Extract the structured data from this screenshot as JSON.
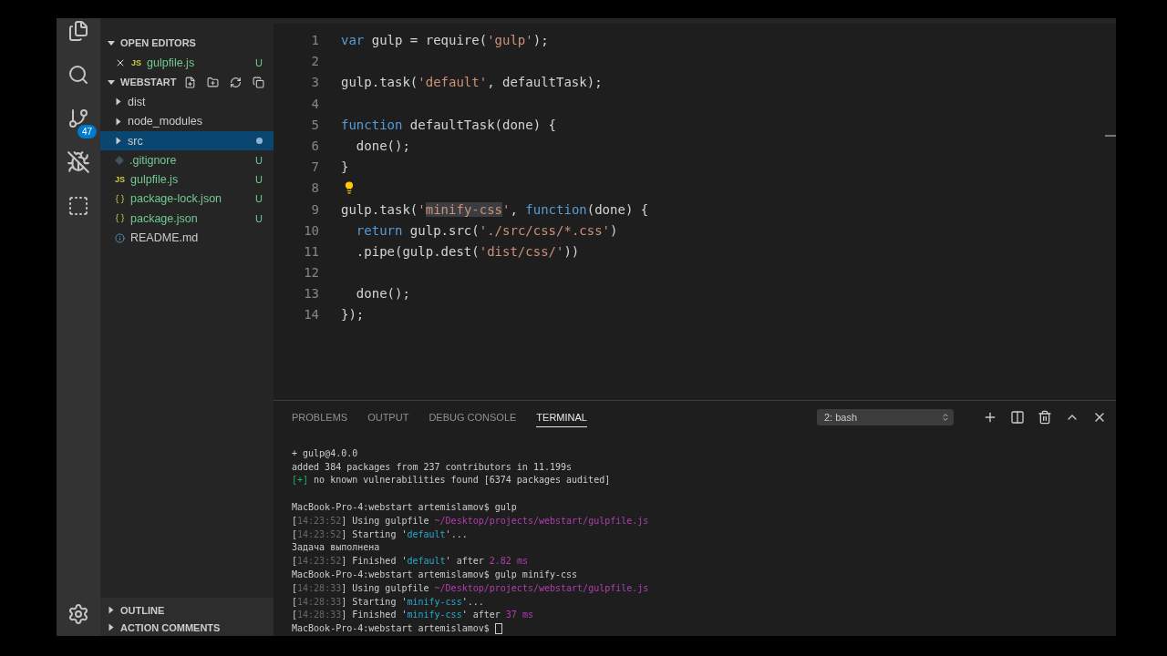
{
  "activity_bar": {
    "items": [
      {
        "kind": "files"
      },
      {
        "kind": "search"
      },
      {
        "kind": "source-control",
        "badge": "47"
      },
      {
        "kind": "debug"
      },
      {
        "kind": "extensions"
      }
    ],
    "bottom_items": [
      {
        "kind": "settings"
      }
    ]
  },
  "sidebar": {
    "sections": [
      {
        "title": "OPEN EDITORS",
        "kind": "open-editors",
        "expanded": true,
        "items": [
          {
            "label": "gulpfile.js",
            "kind": "js-editor",
            "icon_label": "JS",
            "status": "U",
            "selected": false,
            "dot": false
          }
        ]
      },
      {
        "title": "WEBSTART",
        "kind": "workspace",
        "expanded": true,
        "items": [
          {
            "label": "dist",
            "kind": "folder",
            "selected": false,
            "dot": false
          },
          {
            "label": "node_modules",
            "kind": "folder",
            "selected": false,
            "dot": false
          },
          {
            "label": "src",
            "kind": "folder",
            "selected": true,
            "dot": true
          },
          {
            "label": ".gitignore",
            "kind": "gitignore-file",
            "status": "U",
            "selected": false,
            "dot": false
          },
          {
            "label": "gulpfile.js",
            "kind": "js-file",
            "icon_label": "JS",
            "status": "U",
            "selected": false,
            "dot": false
          },
          {
            "label": "package-lock.json",
            "kind": "json-file",
            "status": "U",
            "selected": false,
            "dot": false
          },
          {
            "label": "package.json",
            "kind": "json-file",
            "status": "U",
            "selected": false,
            "dot": false
          },
          {
            "label": "README.md",
            "kind": "info-file",
            "selected": false,
            "dot": false
          }
        ]
      }
    ],
    "bottom_sections": [
      {
        "title": "OUTLINE",
        "expanded": false
      },
      {
        "title": "ACTION COMMENTS",
        "expanded": false
      }
    ]
  },
  "editor": {
    "lines": [
      {
        "number": "1",
        "lightbulb": false,
        "tokens": [
          {
            "kind": "kw",
            "text": "var"
          },
          {
            "kind": "plain",
            "text": " gulp = require("
          },
          {
            "kind": "str",
            "text": "'gulp'"
          },
          {
            "kind": "plain",
            "text": ");"
          }
        ]
      },
      {
        "number": "2",
        "lightbulb": false
      },
      {
        "number": "3",
        "lightbulb": false,
        "tokens": [
          {
            "kind": "plain",
            "text": "gulp.task("
          },
          {
            "kind": "str",
            "text": "'default'"
          },
          {
            "kind": "plain",
            "text": ", defaultTask);"
          }
        ]
      },
      {
        "number": "4",
        "lightbulb": false
      },
      {
        "number": "5",
        "lightbulb": false,
        "tokens": [
          {
            "kind": "kw",
            "text": "function"
          },
          {
            "kind": "plain",
            "text": " defaultTask(done) {"
          }
        ]
      },
      {
        "number": "6",
        "lightbulb": false,
        "tokens": [
          {
            "kind": "plain",
            "text": "  done();"
          }
        ]
      },
      {
        "number": "7",
        "lightbulb": false,
        "tokens": [
          {
            "kind": "plain",
            "text": "}"
          }
        ]
      },
      {
        "number": "8",
        "lightbulb": true
      },
      {
        "number": "9",
        "lightbulb": false,
        "tokens": [
          {
            "kind": "plain",
            "text": "gulp.task("
          },
          {
            "kind": "str",
            "text": "'"
          },
          {
            "kind": "match",
            "text": "minify-css"
          },
          {
            "kind": "str",
            "text": "'"
          },
          {
            "kind": "plain",
            "text": ", "
          },
          {
            "kind": "kw",
            "text": "function"
          },
          {
            "kind": "plain",
            "text": "(done) {"
          }
        ]
      },
      {
        "number": "10",
        "lightbulb": false,
        "tokens": [
          {
            "kind": "kw",
            "text": "  return"
          },
          {
            "kind": "plain",
            "text": " gulp.src("
          },
          {
            "kind": "str",
            "text": "'./src/css/*.css'"
          },
          {
            "kind": "plain",
            "text": ")"
          }
        ]
      },
      {
        "number": "11",
        "lightbulb": false,
        "tokens": [
          {
            "kind": "plain",
            "text": "  .pipe(gulp.dest("
          },
          {
            "kind": "str",
            "text": "'dist/css/'"
          },
          {
            "kind": "plain",
            "text": "))"
          }
        ]
      },
      {
        "number": "12",
        "lightbulb": false
      },
      {
        "number": "13",
        "lightbulb": false,
        "tokens": [
          {
            "kind": "plain",
            "text": "  done();"
          }
        ]
      },
      {
        "number": "14",
        "lightbulb": false,
        "tokens": [
          {
            "kind": "plain",
            "text": "});"
          }
        ]
      }
    ]
  },
  "panel": {
    "tabs": [
      {
        "label": "PROBLEMS",
        "selected": false
      },
      {
        "label": "OUTPUT",
        "selected": false
      },
      {
        "label": "DEBUG CONSOLE",
        "selected": false
      },
      {
        "label": "TERMINAL",
        "selected": true
      }
    ],
    "terminal_select": "2: bash",
    "terminal": {
      "cursor": true,
      "lines": [
        {
          "kind": "text",
          "tokens": [
            {
              "kind": "plain",
              "text": "+ gulp@4.0.0"
            }
          ]
        },
        {
          "kind": "text",
          "tokens": [
            {
              "kind": "plain",
              "text": "added 384 packages from 237 contributors in 11.199s"
            }
          ]
        },
        {
          "kind": "text",
          "tokens": [
            {
              "kind": "green",
              "text": "[+]"
            },
            {
              "kind": "plain",
              "text": " no known vulnerabilities found [6374 packages audited]"
            }
          ]
        },
        {
          "kind": "blank"
        },
        {
          "kind": "text",
          "tokens": [
            {
              "kind": "plain",
              "text": "MacBook-Pro-4:webstart artemislamov$ gulp"
            }
          ]
        },
        {
          "kind": "text",
          "tokens": [
            {
              "kind": "plain",
              "text": "["
            },
            {
              "kind": "dim",
              "text": "14:23:52"
            },
            {
              "kind": "plain",
              "text": "] Using gulpfile "
            },
            {
              "kind": "magenta",
              "text": "~/Desktop/projects/webstart/gulpfile.js"
            }
          ]
        },
        {
          "kind": "text",
          "tokens": [
            {
              "kind": "plain",
              "text": "["
            },
            {
              "kind": "dim",
              "text": "14:23:52"
            },
            {
              "kind": "plain",
              "text": "] Starting '"
            },
            {
              "kind": "cyan",
              "text": "default"
            },
            {
              "kind": "plain",
              "text": "'..."
            }
          ]
        },
        {
          "kind": "text",
          "tokens": [
            {
              "kind": "plain",
              "text": "Задача выполнена"
            }
          ]
        },
        {
          "kind": "text",
          "tokens": [
            {
              "kind": "plain",
              "text": "["
            },
            {
              "kind": "dim",
              "text": "14:23:52"
            },
            {
              "kind": "plain",
              "text": "] Finished '"
            },
            {
              "kind": "cyan",
              "text": "default"
            },
            {
              "kind": "plain",
              "text": "' after "
            },
            {
              "kind": "magenta",
              "text": "2.82 ms"
            }
          ]
        },
        {
          "kind": "text",
          "tokens": [
            {
              "kind": "plain",
              "text": "MacBook-Pro-4:webstart artemislamov$ gulp minify-css"
            }
          ]
        },
        {
          "kind": "text",
          "tokens": [
            {
              "kind": "plain",
              "text": "["
            },
            {
              "kind": "dim",
              "text": "14:28:33"
            },
            {
              "kind": "plain",
              "text": "] Using gulpfile "
            },
            {
              "kind": "magenta",
              "text": "~/Desktop/projects/webstart/gulpfile.js"
            }
          ]
        },
        {
          "kind": "text",
          "tokens": [
            {
              "kind": "plain",
              "text": "["
            },
            {
              "kind": "dim",
              "text": "14:28:33"
            },
            {
              "kind": "plain",
              "text": "] Starting '"
            },
            {
              "kind": "cyan",
              "text": "minify-css"
            },
            {
              "kind": "plain",
              "text": "'..."
            }
          ]
        },
        {
          "kind": "text",
          "tokens": [
            {
              "kind": "plain",
              "text": "["
            },
            {
              "kind": "dim",
              "text": "14:28:33"
            },
            {
              "kind": "plain",
              "text": "] Finished '"
            },
            {
              "kind": "cyan",
              "text": "minify-css"
            },
            {
              "kind": "plain",
              "text": "' after "
            },
            {
              "kind": "magenta",
              "text": "37 ms"
            }
          ]
        },
        {
          "kind": "text",
          "tokens": [
            {
              "kind": "plain",
              "text": "MacBook-Pro-4:webstart artemislamov$"
            }
          ]
        }
      ]
    }
  }
}
